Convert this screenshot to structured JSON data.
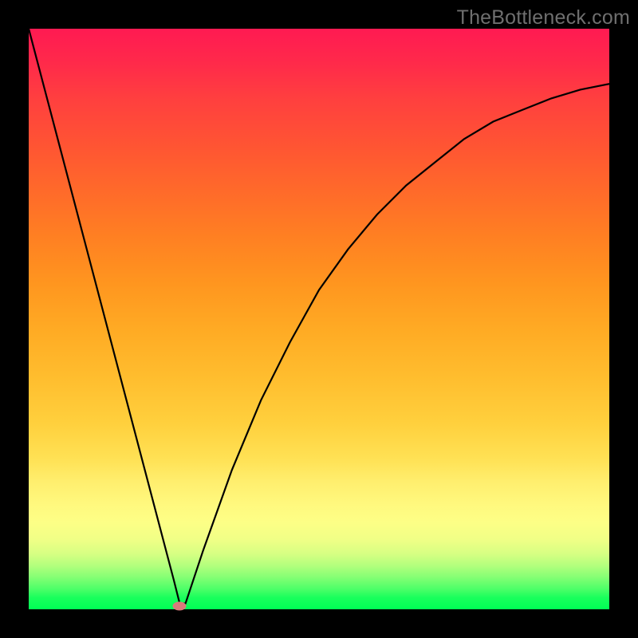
{
  "watermark": "TheBottleneck.com",
  "chart_data": {
    "type": "line",
    "title": "",
    "xlabel": "",
    "ylabel": "",
    "xlim": [
      0,
      100
    ],
    "ylim": [
      0,
      100
    ],
    "grid": false,
    "legend": false,
    "series": [
      {
        "name": "curve",
        "x": [
          0,
          5,
          10,
          15,
          20,
          25,
          26,
          27,
          30,
          35,
          40,
          45,
          50,
          55,
          60,
          65,
          70,
          75,
          80,
          85,
          90,
          95,
          100
        ],
        "y": [
          100,
          81,
          62,
          43,
          24,
          5,
          1,
          1,
          10,
          24,
          36,
          46,
          55,
          62,
          68,
          73,
          77,
          81,
          84,
          86,
          88,
          89.5,
          90.5
        ]
      }
    ],
    "marker": {
      "x": 26,
      "y": 0.5,
      "color": "#d97b7b"
    },
    "background_gradient": {
      "direction": "vertical",
      "stops": [
        {
          "pos": 0,
          "color": "#ff1a52"
        },
        {
          "pos": 50,
          "color": "#ff961f"
        },
        {
          "pos": 85,
          "color": "#fdff86"
        },
        {
          "pos": 100,
          "color": "#00ff55"
        }
      ]
    },
    "frame_color": "#000000"
  }
}
